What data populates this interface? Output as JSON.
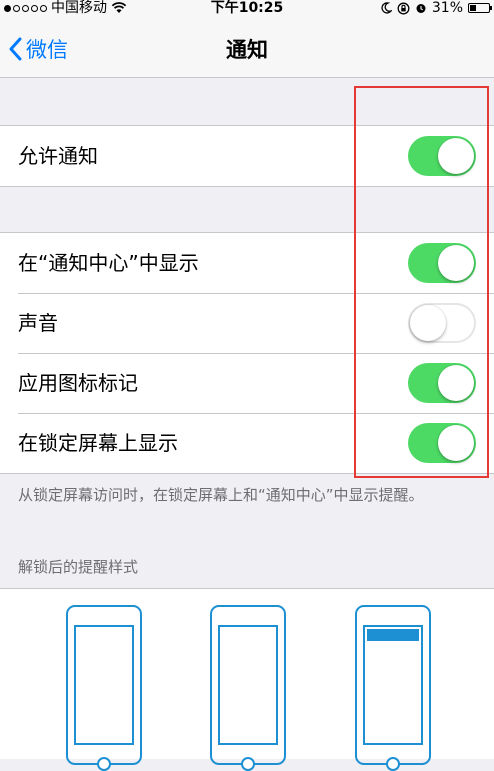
{
  "status_bar": {
    "carrier": "中国移动",
    "time": "下午10:25",
    "battery_percent": "31%",
    "battery_level": 0.31
  },
  "nav": {
    "back_label": "微信",
    "title": "通知"
  },
  "settings": {
    "allow_notifications": {
      "label": "允许通知",
      "on": true
    },
    "items": [
      {
        "label": "在“通知中心”中显示",
        "on": true
      },
      {
        "label": "声音",
        "on": false
      },
      {
        "label": "应用图标标记",
        "on": true
      },
      {
        "label": "在锁定屏幕上显示",
        "on": true
      }
    ]
  },
  "footnote": "从锁定屏幕访问时，在锁定屏幕上和“通知中心”中显示提醒。",
  "alert_style_header": "解锁后的提醒样式",
  "alert_styles": [
    "none",
    "banner",
    "alert"
  ],
  "colors": {
    "accent": "#007aff",
    "toggle_on": "#4cd964",
    "highlight": "#e53935",
    "phone_icon": "#1d8fd3"
  }
}
